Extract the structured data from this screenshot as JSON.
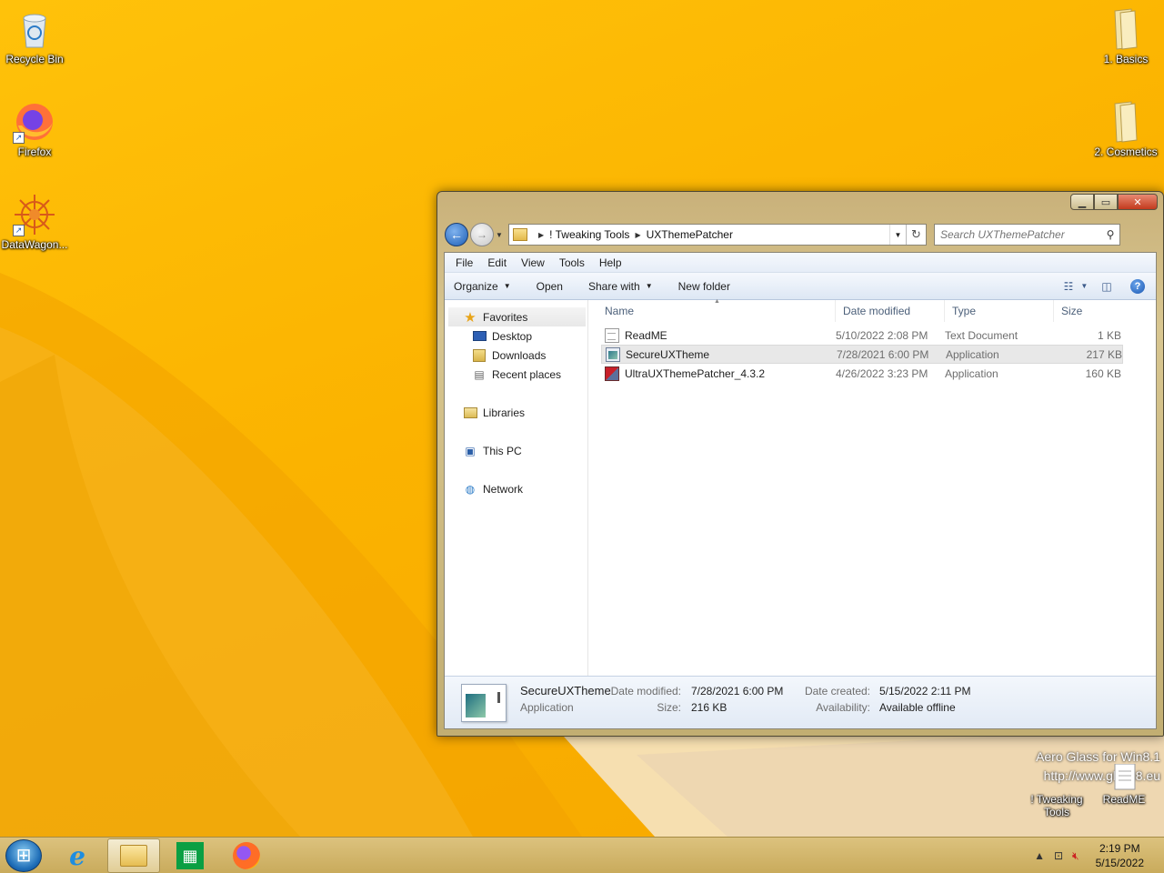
{
  "desktop": {
    "icons_left": [
      {
        "label": "Recycle Bin",
        "icon": "recycle-bin-icon"
      },
      {
        "label": "Firefox",
        "icon": "firefox-icon"
      },
      {
        "label": "DataWagon...",
        "icon": "datawagon-icon"
      }
    ],
    "icons_right": [
      {
        "label": "1. Basics",
        "icon": "folder-icon"
      },
      {
        "label": "2. Cosmetics",
        "icon": "folder-icon"
      }
    ],
    "icons_bottom_right": [
      {
        "label": "! Tweaking\nTools",
        "icon": "folder-icon"
      },
      {
        "label": "ReadME",
        "icon": "text-file-icon"
      }
    ],
    "watermark_line1": "Aero Glass for Win8.1",
    "watermark_line2": "http://www.glass8.eu"
  },
  "window": {
    "breadcrumb": [
      "! Tweaking Tools",
      "UXThemePatcher"
    ],
    "search_placeholder": "Search UXThemePatcher",
    "menu": [
      "File",
      "Edit",
      "View",
      "Tools",
      "Help"
    ],
    "commands": [
      {
        "label": "Organize",
        "dropdown": true
      },
      {
        "label": "Open",
        "dropdown": false
      },
      {
        "label": "Share with",
        "dropdown": true
      },
      {
        "label": "New folder",
        "dropdown": false
      }
    ],
    "nav": {
      "favorites": "Favorites",
      "favorites_items": [
        "Desktop",
        "Downloads",
        "Recent places"
      ],
      "libraries": "Libraries",
      "this_pc": "This PC",
      "network": "Network"
    },
    "columns": {
      "name": "Name",
      "date": "Date modified",
      "type": "Type",
      "size": "Size"
    },
    "files": [
      {
        "name": "ReadME",
        "date": "5/10/2022 2:08 PM",
        "type": "Text Document",
        "size": "1 KB",
        "icon": "txt"
      },
      {
        "name": "SecureUXTheme",
        "date": "7/28/2021 6:00 PM",
        "type": "Application",
        "size": "217 KB",
        "icon": "app",
        "selected": true
      },
      {
        "name": "UltraUXThemePatcher_4.3.2",
        "date": "4/26/2022 3:23 PM",
        "type": "Application",
        "size": "160 KB",
        "icon": "patch"
      }
    ],
    "details": {
      "name": "SecureUXTheme",
      "type": "Application",
      "date_modified_label": "Date modified:",
      "date_modified": "7/28/2021 6:00 PM",
      "size_label": "Size:",
      "size": "216 KB",
      "date_created_label": "Date created:",
      "date_created": "5/15/2022 2:11 PM",
      "availability_label": "Availability:",
      "availability": "Available offline"
    }
  },
  "taskbar": {
    "time": "2:19 PM",
    "date": "5/15/2022"
  }
}
